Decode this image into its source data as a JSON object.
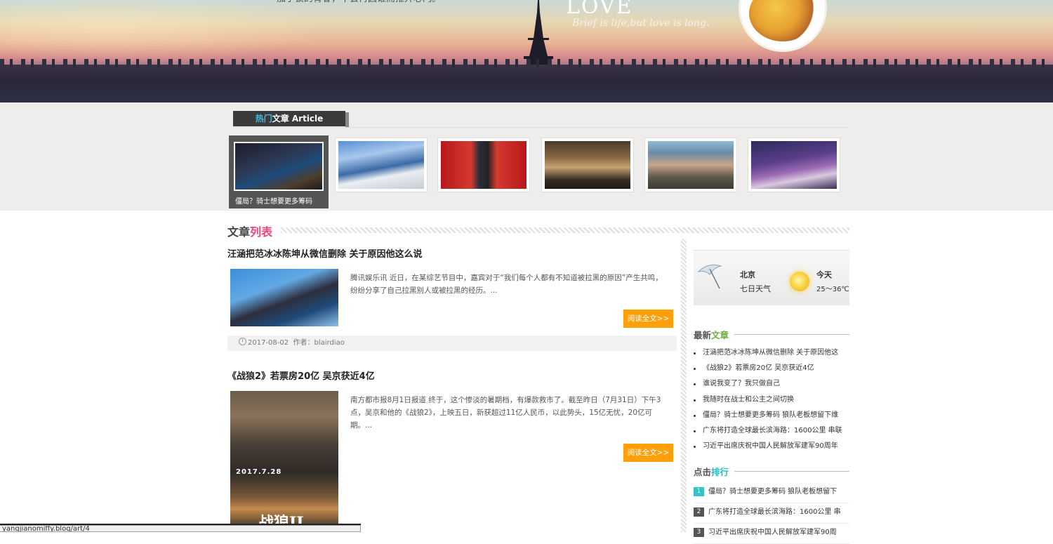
{
  "banner": {
    "tagline_line1": "",
    "tagline_line2": "加了锁的青春，不会再因谁而推开心门。",
    "love_title": "LOVE",
    "love_sub": "Brief is life,but love is long."
  },
  "hot": {
    "tab_prefix": "热门",
    "tab_rest": "文章 Article",
    "active_caption": "僵局？骑士想要更多筹码"
  },
  "section_title": {
    "left": "文章",
    "right": "列表"
  },
  "articles": [
    {
      "title": "汪涵把范冰冰陈坤从微信删除 关于原因他这么说",
      "excerpt": "腾讯娱乐讯 近日，在某综艺节目中，嘉宾对于“我们每个人都有不知道被拉黑的原因”产生共鸣，纷纷分享了自己拉黑别人或被拉黑的经历。...",
      "read_more": "阅读全文>>",
      "date": "2017-08-02",
      "author": "作者：blairdiao"
    },
    {
      "title": "《战狼2》若票房20亿 吴京获近4亿",
      "excerpt": "南方都市报8月1日报道 终于，这个惨淡的暑期档，有爆款救市了。截至昨日（7月31日）下午3点，吴京和他的《战狼2》，上映五日，新获超过11亿人民币，以此势头，15亿无忧，20亿可期。...",
      "read_more": "阅读全文>>",
      "poster_text": "2017.7.28",
      "poster_logo": "战狼II"
    }
  ],
  "weather": {
    "city": "北京",
    "sub": "七日天气",
    "today": "今天",
    "temp": "25～36℃"
  },
  "latest": {
    "head_left": "最新",
    "head_right": "文章",
    "items": [
      "汪涵把范冰冰陈坤从微信删除 关于原因他这",
      "《战狼2》若票房20亿 吴京获近4亿",
      "谁说我变了？我只做自己",
      "我随时在战士和公主之间切换",
      "僵局？骑士想要更多筹码 狼队老板想留下维",
      "广东将打造全球最长滨海路：1600公里 串联",
      "习近平出席庆祝中国人民解放军建军90周年"
    ]
  },
  "ranking": {
    "head_left": "点击",
    "head_right": "排行",
    "items": [
      {
        "num": "1",
        "text": "僵局？骑士想要更多筹码 狼队老板想留下",
        "color": "#36c2c9"
      },
      {
        "num": "2",
        "text": "广东将打造全球最长滨海路：1600公里 串",
        "color": "#555555"
      },
      {
        "num": "3",
        "text": "习近平出席庆祝中国人民解放军建军90周",
        "color": "#555555"
      }
    ]
  },
  "statusbar": {
    "url": "yangjianomiffy.blog/art/4"
  },
  "colors": {
    "accent_orange": "#ff9f0a",
    "accent_pink": "#f0487e",
    "accent_blue": "#43b8e0",
    "accent_green": "#6fae3c",
    "accent_teal": "#32b7c0"
  }
}
